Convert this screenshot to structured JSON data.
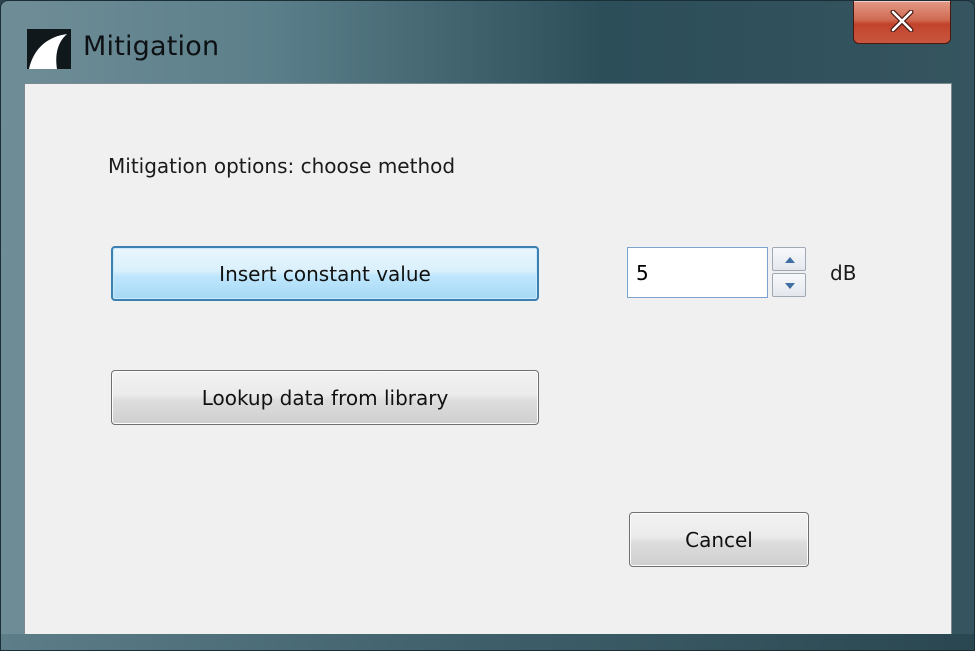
{
  "window": {
    "title": "Mitigation",
    "icon": "shark-fin-app-icon",
    "close_icon": "close-x-icon"
  },
  "dialog": {
    "prompt": "Mitigation options: choose method",
    "insert_constant_label": "Insert constant value",
    "lookup_library_label": "Lookup data from library",
    "constant_value": "5",
    "unit": "dB",
    "cancel_label": "Cancel"
  },
  "colors": {
    "focused_button_border": "#3c7fb1",
    "close_button": "#c9563f",
    "dialog_background": "#f0f0f0"
  }
}
